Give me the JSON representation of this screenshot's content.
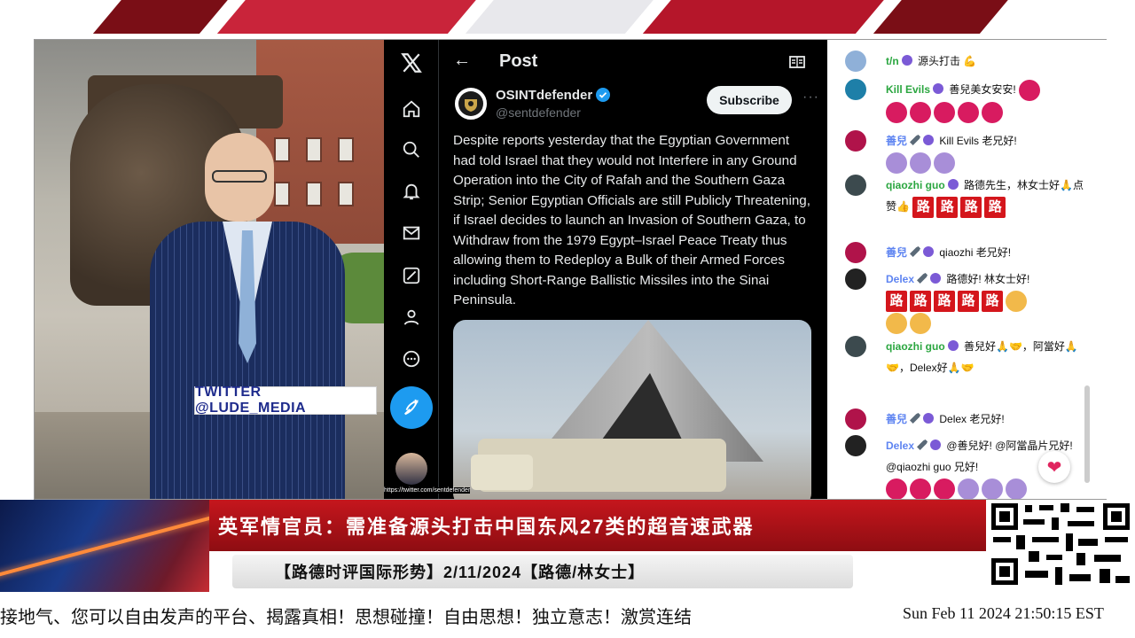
{
  "camera": {
    "handle_label": "TWITTER  @LUDE_MEDIA"
  },
  "x_post": {
    "page_title": "Post",
    "author_name": "OSINTdefender",
    "author_handle": "@sentdefender",
    "subscribe_label": "Subscribe",
    "more_label": "···",
    "text": "Despite reports yesterday that the Egyptian Government had told Israel that they would not Interfere in any Ground Operation into the City of Rafah and the Southern Gaza Strip; Senior Egyptian Officials are still Publicly Threatening, if Israel decides to launch an Invasion of Southern Gaza, to Withdraw from the 1979 Egypt–Israel Peace Treaty thus allowing them to Redeploy a Bulk of their Armed Forces including Short-Range Ballistic Missiles into the Sinai Peninsula.",
    "media_url": "https://twitter.com/sentdefender",
    "nav_icons": [
      "x-logo-icon",
      "home-icon",
      "search-icon",
      "bell-icon",
      "mail-icon",
      "grok-icon",
      "profile-icon",
      "more-circle-icon"
    ]
  },
  "chat": {
    "messages": [
      {
        "author": "t/n",
        "text": "源头打击 💪"
      },
      {
        "author": "Kill Evils",
        "text": "善兒美女安安!"
      },
      {
        "author": "善兒",
        "text": "Kill Evils 老兄好!"
      },
      {
        "author": "qiaozhi guo",
        "text": "路德先生，林女士好🙏点赞👍",
        "lu": "路"
      },
      {
        "author": "善兒",
        "text": "qiaozhi 老兄好!"
      },
      {
        "author": "Delex",
        "text": "路德好! 林女士好!"
      },
      {
        "author": "qiaozhi guo",
        "text": "善兒好🙏🤝，阿當好🙏🤝，Delex好🙏🤝"
      },
      {
        "author": "善兒",
        "text": "Delex 老兄好!"
      },
      {
        "author": "Delex",
        "text": "@善兒好! @阿當晶片兄好! @qiaozhi guo 兄好!"
      }
    ]
  },
  "lower_third": {
    "headline": "英军情官员：需准备源头打击中国东风27类的超音速武器",
    "subline": "【路德时评国际形势】2/11/2024【路德/林女士】"
  },
  "ticker": {
    "text": "接地气、您可以自由发声的平台、揭露真相！思想碰撞！自由思想！独立意志！激赏连结",
    "clock": "Sun Feb 11 2024 21:50:15 EST"
  },
  "colors": {
    "twitter_blue": "#1d9bf0",
    "headline_red": "#c5161d",
    "handle_blue": "#1e2b8c"
  }
}
